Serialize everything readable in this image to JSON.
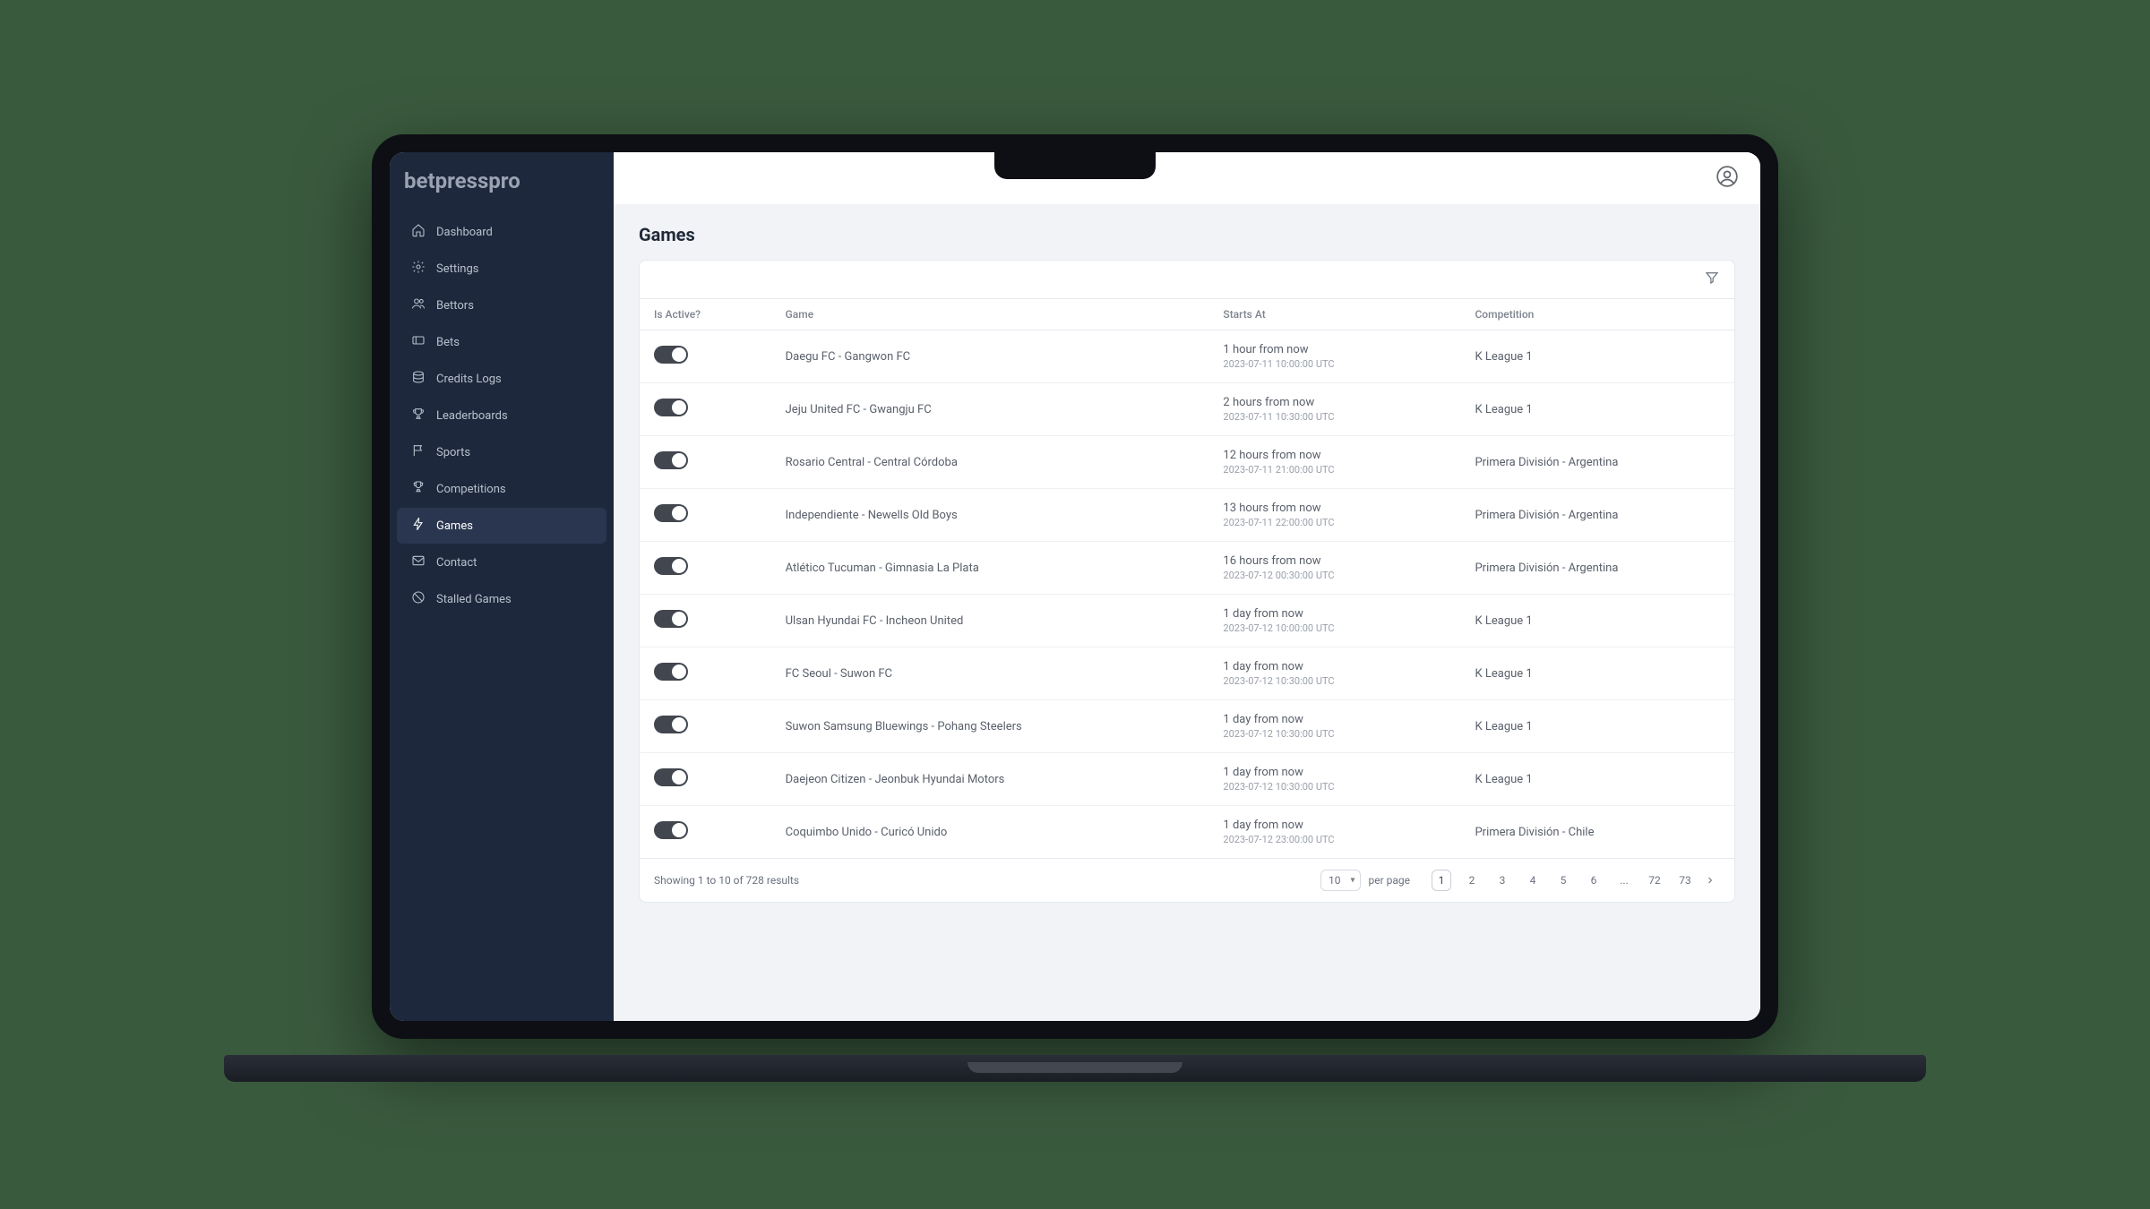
{
  "brand": "betpresspro",
  "page_title": "Games",
  "sidebar": {
    "items": [
      {
        "label": "Dashboard",
        "icon": "home-icon"
      },
      {
        "label": "Settings",
        "icon": "gear-icon"
      },
      {
        "label": "Bettors",
        "icon": "users-icon"
      },
      {
        "label": "Bets",
        "icon": "ticket-icon"
      },
      {
        "label": "Credits Logs",
        "icon": "stack-icon"
      },
      {
        "label": "Leaderboards",
        "icon": "trophy-icon"
      },
      {
        "label": "Sports",
        "icon": "flag-icon"
      },
      {
        "label": "Competitions",
        "icon": "cup-icon"
      },
      {
        "label": "Games",
        "icon": "bolt-icon"
      },
      {
        "label": "Contact",
        "icon": "mail-icon"
      },
      {
        "label": "Stalled Games",
        "icon": "block-icon"
      }
    ],
    "active_index": 8
  },
  "table": {
    "columns": [
      "Is Active?",
      "Game",
      "Starts At",
      "Competition"
    ],
    "rows": [
      {
        "active": true,
        "game": "Daegu FC - Gangwon FC",
        "starts_rel": "1 hour from now",
        "starts_abs": "2023-07-11 10:00:00 UTC",
        "competition": "K League 1"
      },
      {
        "active": true,
        "game": "Jeju United FC - Gwangju FC",
        "starts_rel": "2 hours from now",
        "starts_abs": "2023-07-11 10:30:00 UTC",
        "competition": "K League 1"
      },
      {
        "active": true,
        "game": "Rosario Central - Central Córdoba",
        "starts_rel": "12 hours from now",
        "starts_abs": "2023-07-11 21:00:00 UTC",
        "competition": "Primera División - Argentina"
      },
      {
        "active": true,
        "game": "Independiente - Newells Old Boys",
        "starts_rel": "13 hours from now",
        "starts_abs": "2023-07-11 22:00:00 UTC",
        "competition": "Primera División - Argentina"
      },
      {
        "active": true,
        "game": "Atlético Tucuman - Gimnasia La Plata",
        "starts_rel": "16 hours from now",
        "starts_abs": "2023-07-12 00:30:00 UTC",
        "competition": "Primera División - Argentina"
      },
      {
        "active": true,
        "game": "Ulsan Hyundai FC - Incheon United",
        "starts_rel": "1 day from now",
        "starts_abs": "2023-07-12 10:00:00 UTC",
        "competition": "K League 1"
      },
      {
        "active": true,
        "game": "FC Seoul - Suwon FC",
        "starts_rel": "1 day from now",
        "starts_abs": "2023-07-12 10:30:00 UTC",
        "competition": "K League 1"
      },
      {
        "active": true,
        "game": "Suwon Samsung Bluewings - Pohang Steelers",
        "starts_rel": "1 day from now",
        "starts_abs": "2023-07-12 10:30:00 UTC",
        "competition": "K League 1"
      },
      {
        "active": true,
        "game": "Daejeon Citizen - Jeonbuk Hyundai Motors",
        "starts_rel": "1 day from now",
        "starts_abs": "2023-07-12 10:30:00 UTC",
        "competition": "K League 1"
      },
      {
        "active": true,
        "game": "Coquimbo Unido - Curicó Unido",
        "starts_rel": "1 day from now",
        "starts_abs": "2023-07-12 23:00:00 UTC",
        "competition": "Primera División - Chile"
      }
    ]
  },
  "pager": {
    "summary": "Showing 1 to 10 of 728 results",
    "per_page_value": "10",
    "per_page_label": "per page",
    "pages": [
      "1",
      "2",
      "3",
      "4",
      "5",
      "6",
      "...",
      "72",
      "73"
    ],
    "current_index": 0
  }
}
